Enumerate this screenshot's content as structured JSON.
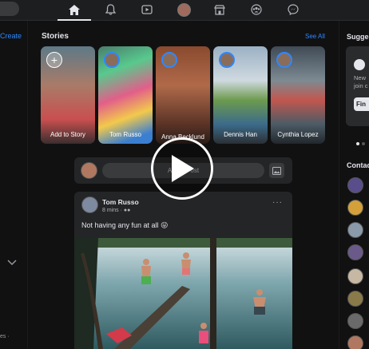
{
  "left": {
    "create_label": "Create",
    "footer_text": "es ·"
  },
  "stories": {
    "title": "Stories",
    "see_all": "See All",
    "items": [
      {
        "name": "Add to Story"
      },
      {
        "name": "Tom Russo"
      },
      {
        "name": "Anna Becklund"
      },
      {
        "name": "Dennis Han"
      },
      {
        "name": "Cynthia Lopez"
      }
    ]
  },
  "composer": {
    "placeholder": "Add a Post"
  },
  "post": {
    "author": "Tom Russo",
    "time": "8 mins · ",
    "text": "Not having any fun at all 😜",
    "more": "···"
  },
  "right": {
    "suggested_title": "Suggested",
    "card_line1": "New",
    "card_line2": "join c",
    "card_button": "Fin",
    "contacts_title": "Contacts"
  },
  "colors": {
    "accent": "#2d88ff",
    "background": "#111112",
    "card": "#242526"
  },
  "icons": [
    "home-icon",
    "bell-icon",
    "watch-icon",
    "avatar",
    "marketplace-icon",
    "groups-icon",
    "messenger-icon",
    "play-icon"
  ]
}
